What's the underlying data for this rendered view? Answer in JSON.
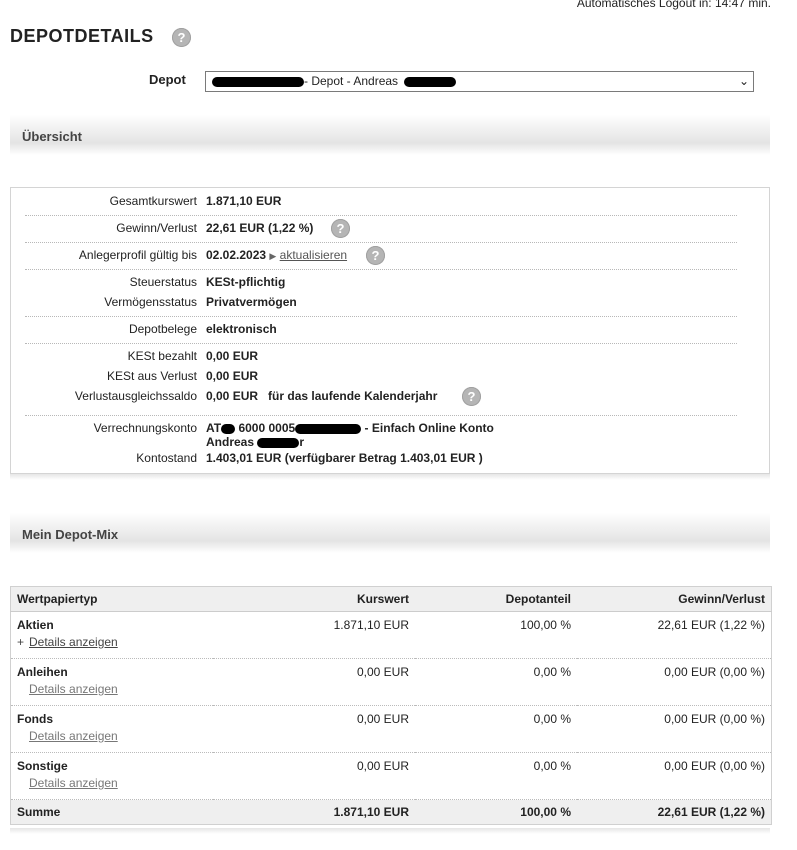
{
  "header": {
    "logout_text": "Automatisches Logout in: 14:47  min.",
    "page_title": "DEPOTDETAILS",
    "help_glyph": "?"
  },
  "depot": {
    "label": "Depot",
    "selected": "- Depot - Andreas"
  },
  "overview": {
    "section_title": "Übersicht",
    "rows": {
      "gesamtkurswert": {
        "label": "Gesamtkurswert",
        "value": "1.871,10 EUR"
      },
      "gewinn": {
        "label": "Gewinn/Verlust",
        "value": "22,61 EUR (1,22 %)"
      },
      "anlegerprofil": {
        "label": "Anlegerprofil gültig bis",
        "value": "02.02.2023",
        "link": "aktualisieren"
      },
      "steuerstatus": {
        "label": "Steuerstatus",
        "value": "KESt-pflichtig"
      },
      "vermoegensstatus": {
        "label": "Vermögensstatus",
        "value": "Privatvermögen"
      },
      "depotbelege": {
        "label": "Depotbelege",
        "value": "elektronisch"
      },
      "kest_bezahlt": {
        "label": "KESt bezahlt",
        "value": "0,00 EUR"
      },
      "kest_verlust": {
        "label": "KESt aus Verlust",
        "value": "0,00 EUR"
      },
      "verlustausgleich": {
        "label": "Verlustausgleichssaldo",
        "value": "0,00 EUR",
        "suffix": "für das laufende Kalenderjahr"
      },
      "verrechnungskonto": {
        "label": "Verrechnungskonto",
        "prefix": "AT",
        "mid": "6000 0005",
        "suffix": "- Einfach Online Konto",
        "line2": "Andreas",
        "line2_end": "r"
      },
      "kontostand": {
        "label": "Kontostand",
        "value": "1.403,01 EUR (verfügbarer Betrag  1.403,01 EUR )"
      }
    }
  },
  "mix": {
    "section_title": "Mein Depot-Mix",
    "columns": [
      "Wertpapiertyp",
      "Kurswert",
      "Depotanteil",
      "Gewinn/Verlust"
    ],
    "details_label": "Details anzeigen",
    "rows": [
      {
        "typ": "Aktien",
        "kurswert": "1.871,10 EUR",
        "anteil": "100,00 %",
        "gv": "22,61 EUR (1,22 %)"
      },
      {
        "typ": "Anleihen",
        "kurswert": "0,00 EUR",
        "anteil": "0,00 %",
        "gv": "0,00 EUR (0,00 %)"
      },
      {
        "typ": "Fonds",
        "kurswert": "0,00 EUR",
        "anteil": "0,00 %",
        "gv": "0,00 EUR (0,00 %)"
      },
      {
        "typ": "Sonstige",
        "kurswert": "0,00 EUR",
        "anteil": "0,00 %",
        "gv": "0,00 EUR (0,00 %)"
      }
    ],
    "sum": {
      "label": "Summe",
      "kurswert": "1.871,10 EUR",
      "anteil": "100,00 %",
      "gv": "22,61 EUR (1,22 %)"
    }
  }
}
